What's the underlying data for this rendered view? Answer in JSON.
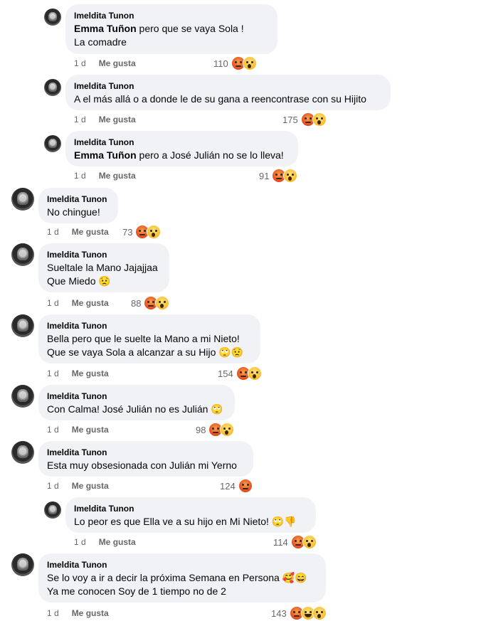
{
  "comments": [
    {
      "author": "Imeldita Tunon",
      "lines": [
        {
          "mention": "Emma Tuñon",
          "text": " pero que se vaya Sola !"
        },
        {
          "text": "La comadre"
        }
      ],
      "time": "1 d",
      "like": "Me gusta",
      "count": "110",
      "reactions": [
        "angry",
        "wow"
      ]
    },
    {
      "author": "Imeldita Tunon",
      "lines": [
        {
          "text": "A el más allá o a donde le de su gana a reencontrase con su Hijito"
        }
      ],
      "time": "1 d",
      "like": "Me gusta",
      "count": "175",
      "reactions": [
        "angry",
        "wow"
      ]
    },
    {
      "author": "Imeldita Tunon",
      "lines": [
        {
          "mention": "Emma Tuñon",
          "text": " pero a José Julián no se lo lleva!"
        }
      ],
      "time": "1 d",
      "like": "Me gusta",
      "count": "91",
      "reactions": [
        "angry",
        "wow"
      ]
    },
    {
      "author": "Imeldita Tunon",
      "lines": [
        {
          "text": "No chingue!"
        }
      ],
      "time": "1 d",
      "like": "Me gusta",
      "count": "73",
      "reactions": [
        "angry",
        "wow"
      ]
    },
    {
      "author": "Imeldita Tunon",
      "lines": [
        {
          "text": "Sueltale la Mano Jajajjaa"
        },
        {
          "text": "Que Miedo 😟"
        }
      ],
      "time": "1 d",
      "like": "Me gusta",
      "count": "88",
      "reactions": [
        "angry",
        "wow"
      ]
    },
    {
      "author": "Imeldita Tunon",
      "lines": [
        {
          "text": "Bella pero que le suelte la Mano a mi Nieto!"
        },
        {
          "text": "Que se vaya Sola a alcanzar a su Hijo 🙄😟"
        }
      ],
      "time": "1 d",
      "like": "Me gusta",
      "count": "154",
      "reactions": [
        "angry",
        "wow"
      ]
    },
    {
      "author": "Imeldita Tunon",
      "lines": [
        {
          "text": "Con Calma! José Julián no es Julián 🙄"
        }
      ],
      "time": "1 d",
      "like": "Me gusta",
      "count": "98",
      "reactions": [
        "angry",
        "wow"
      ]
    },
    {
      "author": "Imeldita Tunon",
      "lines": [
        {
          "text": "Esta muy obsesionada con Julián mi Yerno"
        }
      ],
      "time": "1 d",
      "like": "Me gusta",
      "count": "124",
      "reactions": [
        "angry"
      ]
    },
    {
      "author": "Imeldita Tunon",
      "lines": [
        {
          "text": "Lo peor es que Ella ve a su hijo en Mi Nieto! 🙄👎"
        }
      ],
      "time": "1 d",
      "like": "Me gusta",
      "count": "114",
      "reactions": [
        "angry",
        "wow"
      ]
    },
    {
      "author": "Imeldita Tunon",
      "lines": [
        {
          "text": "Se lo voy a ir a decir la próxima Semana en Persona 🥰😄"
        },
        {
          "text": "Ya me conocen Soy de 1 tiempo no de 2"
        }
      ],
      "time": "1 d",
      "like": "Me gusta",
      "count": "143",
      "reactions": [
        "angry",
        "haha",
        "wow"
      ]
    }
  ]
}
